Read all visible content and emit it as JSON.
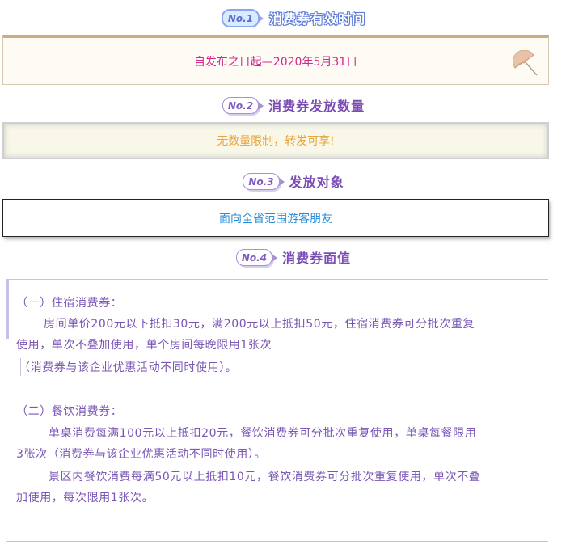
{
  "sections": [
    {
      "badge": "No.1",
      "title": "消费券有效时间",
      "content": "自发布之日起—2020年5月31日"
    },
    {
      "badge": "No.2",
      "title": "消费券发放数量",
      "content": "无数量限制，转发可享!"
    },
    {
      "badge": "No.3",
      "title": "发放对象",
      "content": "面向全省范围游客朋友"
    },
    {
      "badge": "No.4",
      "title": "消费券面值"
    }
  ],
  "detail": {
    "lodging_heading": "（一）住宿消费券：",
    "lodging_line1": "房间单价200元以下抵扣30元，满200元以上抵扣50元，住宿消费券可分批次重复",
    "lodging_line2": "使用，单次不叠加使用，单个房间每晚限用1张次",
    "lodging_line3": "（消费券与该企业优惠活动不同时使用）。",
    "dining_heading": "（二）餐饮消费券：",
    "dining_line1": "单桌消费每满100元以上抵扣20元，餐饮消费券可分批次重复使用，单桌每餐限用",
    "dining_line2": "3张次（消费券与该企业优惠活动不同时使用）。",
    "dining_line3": "景区内餐饮消费每满50元以上抵扣10元，餐饮消费券可分批次重复使用，单次不叠",
    "dining_line4": "加使用，每次限用1张次。"
  },
  "icons": {
    "decoration": "parasol-icon"
  },
  "colors": {
    "accent": "#7a4db6",
    "date_text": "#d12a8c",
    "quantity_text": "#e8a33a",
    "audience_text": "#2a8fd6",
    "body_text": "#7a56b5"
  }
}
